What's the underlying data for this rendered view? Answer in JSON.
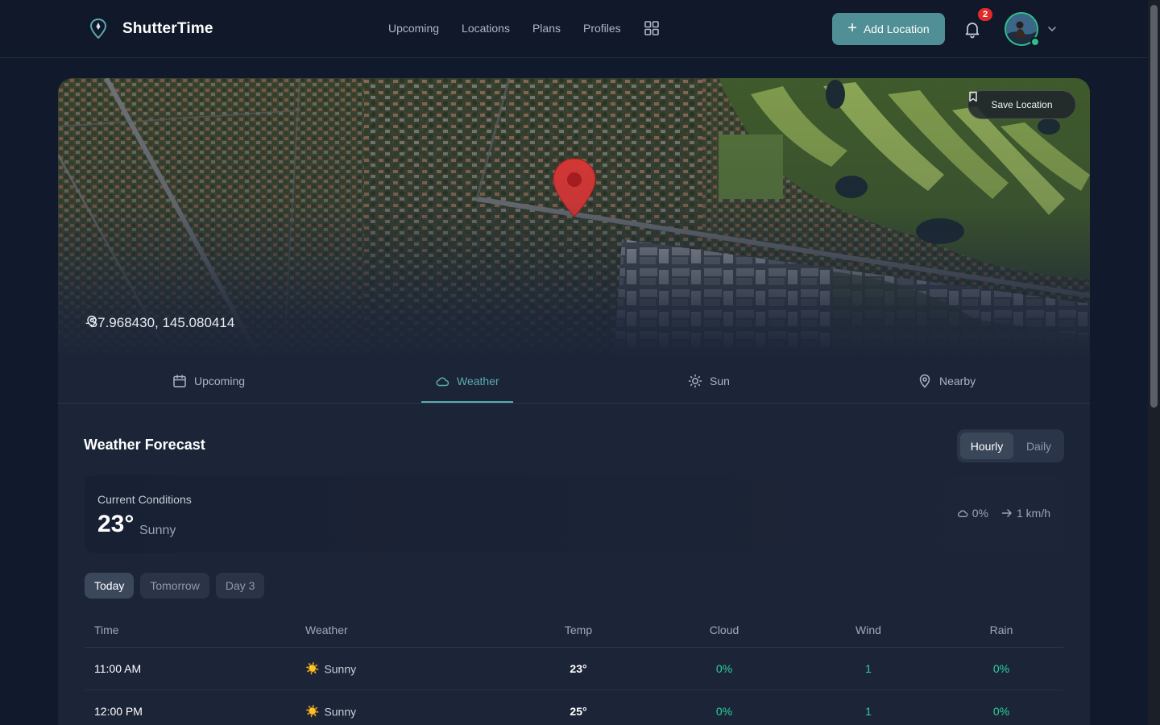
{
  "app": {
    "name": "ShutterTime"
  },
  "nav": {
    "items": [
      "Upcoming",
      "Locations",
      "Plans",
      "Profiles"
    ]
  },
  "header": {
    "add_location": "Add Location",
    "notification_count": "2"
  },
  "map": {
    "coordinates": "-37.968430, 145.080414",
    "save_label": "Save Location"
  },
  "tabs": [
    {
      "label": "Upcoming",
      "icon": "calendar-icon"
    },
    {
      "label": "Weather",
      "icon": "cloud-icon",
      "active": true
    },
    {
      "label": "Sun",
      "icon": "sun-icon"
    },
    {
      "label": "Nearby",
      "icon": "map-pin-icon"
    }
  ],
  "forecast": {
    "title": "Weather Forecast",
    "modes": [
      "Hourly",
      "Daily"
    ],
    "active_mode": "Hourly",
    "current": {
      "label": "Current Conditions",
      "temp": "23°",
      "condition": "Sunny",
      "cloud": "0%",
      "wind": "1 km/h"
    },
    "days": [
      "Today",
      "Tomorrow",
      "Day 3"
    ],
    "active_day": "Today",
    "columns": [
      "Time",
      "Weather",
      "Temp",
      "Cloud",
      "Wind",
      "Rain"
    ],
    "rows": [
      {
        "time": "11:00 AM",
        "weather": "Sunny",
        "temp": "23°",
        "cloud": "0%",
        "wind": "1",
        "rain": "0%"
      },
      {
        "time": "12:00 PM",
        "weather": "Sunny",
        "temp": "25°",
        "cloud": "0%",
        "wind": "1",
        "rain": "0%"
      }
    ]
  },
  "colors": {
    "accent": "#5aaab0",
    "button": "#4f8f95",
    "positive": "#2dd09a",
    "pin": "#e53935"
  }
}
